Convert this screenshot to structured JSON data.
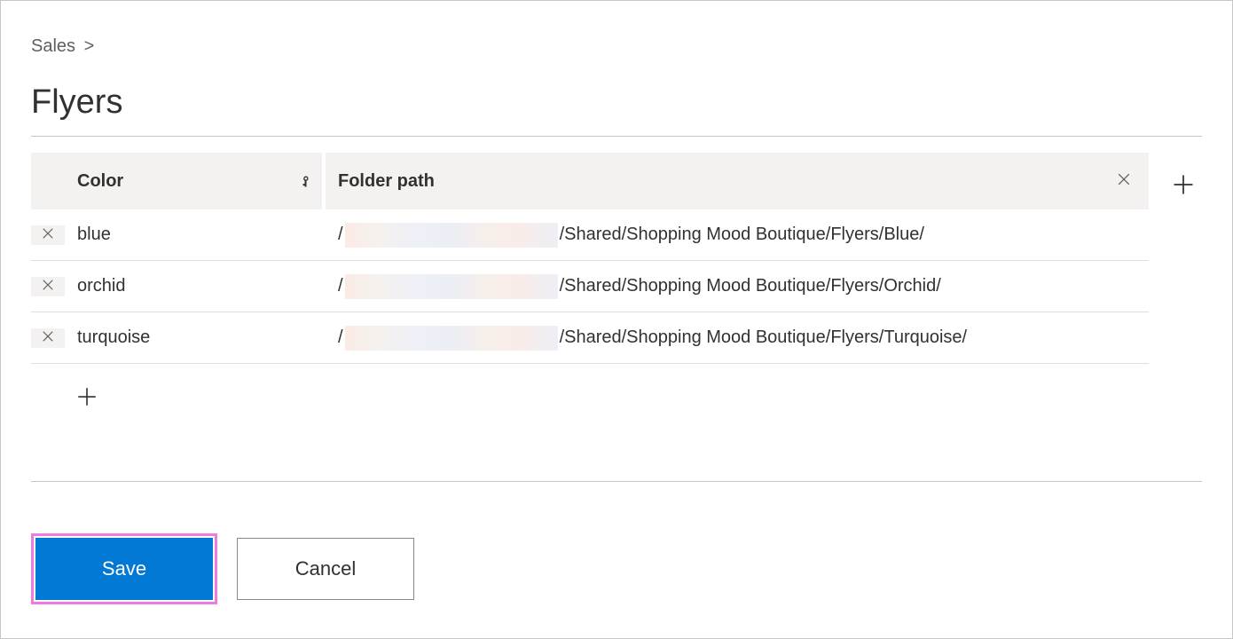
{
  "breadcrumb": {
    "parent": "Sales",
    "separator": ">"
  },
  "title": "Flyers",
  "table": {
    "columns": {
      "color": "Color",
      "folder_path": "Folder path"
    },
    "rows": [
      {
        "color": "blue",
        "prefix": "/",
        "suffix": "/Shared/Shopping Mood Boutique/Flyers/Blue/"
      },
      {
        "color": "orchid",
        "prefix": "/",
        "suffix": "/Shared/Shopping Mood Boutique/Flyers/Orchid/"
      },
      {
        "color": "turquoise",
        "prefix": "/",
        "suffix": "/Shared/Shopping Mood Boutique/Flyers/Turquoise/"
      }
    ]
  },
  "buttons": {
    "save": "Save",
    "cancel": "Cancel"
  }
}
